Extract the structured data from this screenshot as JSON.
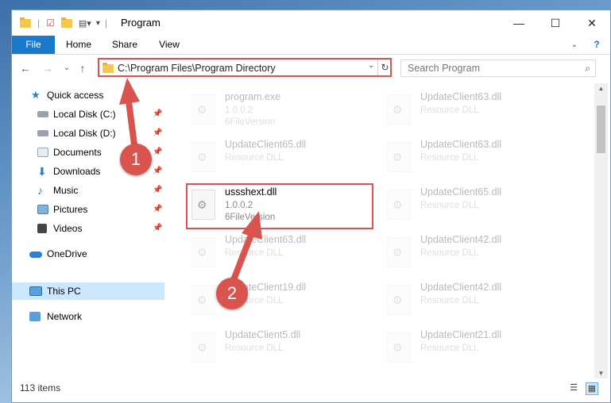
{
  "window": {
    "title": "Program",
    "controls": {
      "minimize": "—",
      "maximize": "☐",
      "close": "✕"
    }
  },
  "ribbon": {
    "tabs": [
      "File",
      "Home",
      "Share",
      "View"
    ],
    "expand_icon": "chevron-down-icon",
    "help_icon": "?"
  },
  "address": {
    "path": "C:\\Program Files\\Program Directory",
    "refresh": "↻",
    "dropdown": "⌄"
  },
  "search": {
    "placeholder": "Search Program",
    "icon": "🔍"
  },
  "nav": {
    "back": "←",
    "forward": "→",
    "recent": "⌄",
    "up": "↑",
    "items": [
      {
        "label": "Quick access",
        "icon": "star-icon",
        "pinned": false
      },
      {
        "label": "Local Disk (C:)",
        "icon": "drive-icon",
        "pinned": true
      },
      {
        "label": "Local Disk (D:)",
        "icon": "drive-icon",
        "pinned": true
      },
      {
        "label": "Documents",
        "icon": "documents-icon",
        "pinned": true
      },
      {
        "label": "Downloads",
        "icon": "downloads-icon",
        "pinned": true
      },
      {
        "label": "Music",
        "icon": "music-icon",
        "pinned": true
      },
      {
        "label": "Pictures",
        "icon": "pictures-icon",
        "pinned": true
      },
      {
        "label": "Videos",
        "icon": "videos-icon",
        "pinned": true
      },
      {
        "label": "OneDrive",
        "icon": "cloud-icon",
        "pinned": false
      },
      {
        "label": "This PC",
        "icon": "computer-icon",
        "pinned": false,
        "selected": true
      },
      {
        "label": "Network",
        "icon": "network-icon",
        "pinned": false
      }
    ]
  },
  "files": [
    {
      "name": "program.exe",
      "line1": "1.0.0.2",
      "line2": "6FileVersion",
      "faded": true
    },
    {
      "name": "UpdateClient63.dll",
      "line1": "Resource DLL",
      "line2": "",
      "faded": true
    },
    {
      "name": "UpdateClient65.dll",
      "line1": "Resource DLL",
      "line2": "",
      "faded": true
    },
    {
      "name": "UpdateClient63.dll",
      "line1": "Resource DLL",
      "line2": "",
      "faded": true
    },
    {
      "name": "ussshext.dll",
      "line1": "1.0.0.2",
      "line2": "6FileVersion",
      "faded": false
    },
    {
      "name": "UpdateClient65.dll",
      "line1": "Resource DLL",
      "line2": "",
      "faded": true
    },
    {
      "name": "UpdateClient63.dll",
      "line1": "Resource DLL",
      "line2": "",
      "faded": true
    },
    {
      "name": "UpdateClient42.dll",
      "line1": "Resource DLL",
      "line2": "",
      "faded": true
    },
    {
      "name": "UpdateClient19.dll",
      "line1": "Resource DLL",
      "line2": "",
      "faded": true
    },
    {
      "name": "UpdateClient42.dll",
      "line1": "Resource DLL",
      "line2": "",
      "faded": true
    },
    {
      "name": "UpdateClient5.dll",
      "line1": "Resource DLL",
      "line2": "",
      "faded": true
    },
    {
      "name": "UpdateClient21.dll",
      "line1": "Resource DLL",
      "line2": "",
      "faded": true
    }
  ],
  "status": {
    "items_count": "113 items"
  },
  "callouts": [
    "1",
    "2"
  ],
  "colors": {
    "accent": "#1979ca",
    "highlight": "#d9534f",
    "selection": "#cce8ff"
  }
}
